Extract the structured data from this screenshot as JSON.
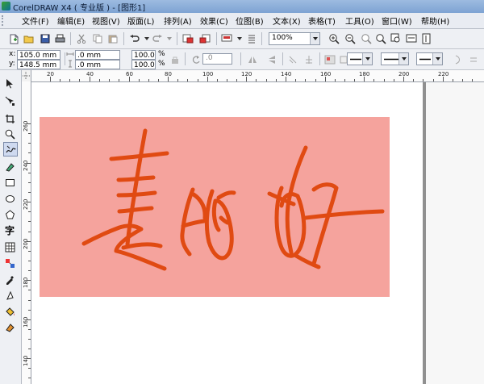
{
  "window": {
    "title": "CorelDRAW X4 ( 专业版 ) - [图形1]"
  },
  "menu": [
    "文件(F)",
    "编辑(E)",
    "视图(V)",
    "版面(L)",
    "排列(A)",
    "效果(C)",
    "位图(B)",
    "文本(X)",
    "表格(T)",
    "工具(O)",
    "窗口(W)",
    "帮助(H)"
  ],
  "toolbar": {
    "zoom_value": "100%"
  },
  "property_bar": {
    "x_label": "x:",
    "x_value": "105.0 mm",
    "y_label": "y:",
    "y_value": "148.5 mm",
    "width_value": ".0 mm",
    "height_value": ".0 mm",
    "scale_x": "100.0",
    "scale_y": "100.0",
    "percent": "%",
    "rotation_value": ".0"
  },
  "ruler": {
    "h_labels": [
      "20",
      "40",
      "60",
      "80",
      "100",
      "120",
      "140",
      "160",
      "180",
      "200",
      "220"
    ],
    "v_labels": [
      "260",
      "240",
      "220",
      "200",
      "180",
      "160",
      "140"
    ]
  },
  "toolbox": {
    "text_tool_glyph": "字"
  },
  "canvas": {
    "rect_fill": "#f5a39d",
    "stroke_color": "#e04a12"
  }
}
